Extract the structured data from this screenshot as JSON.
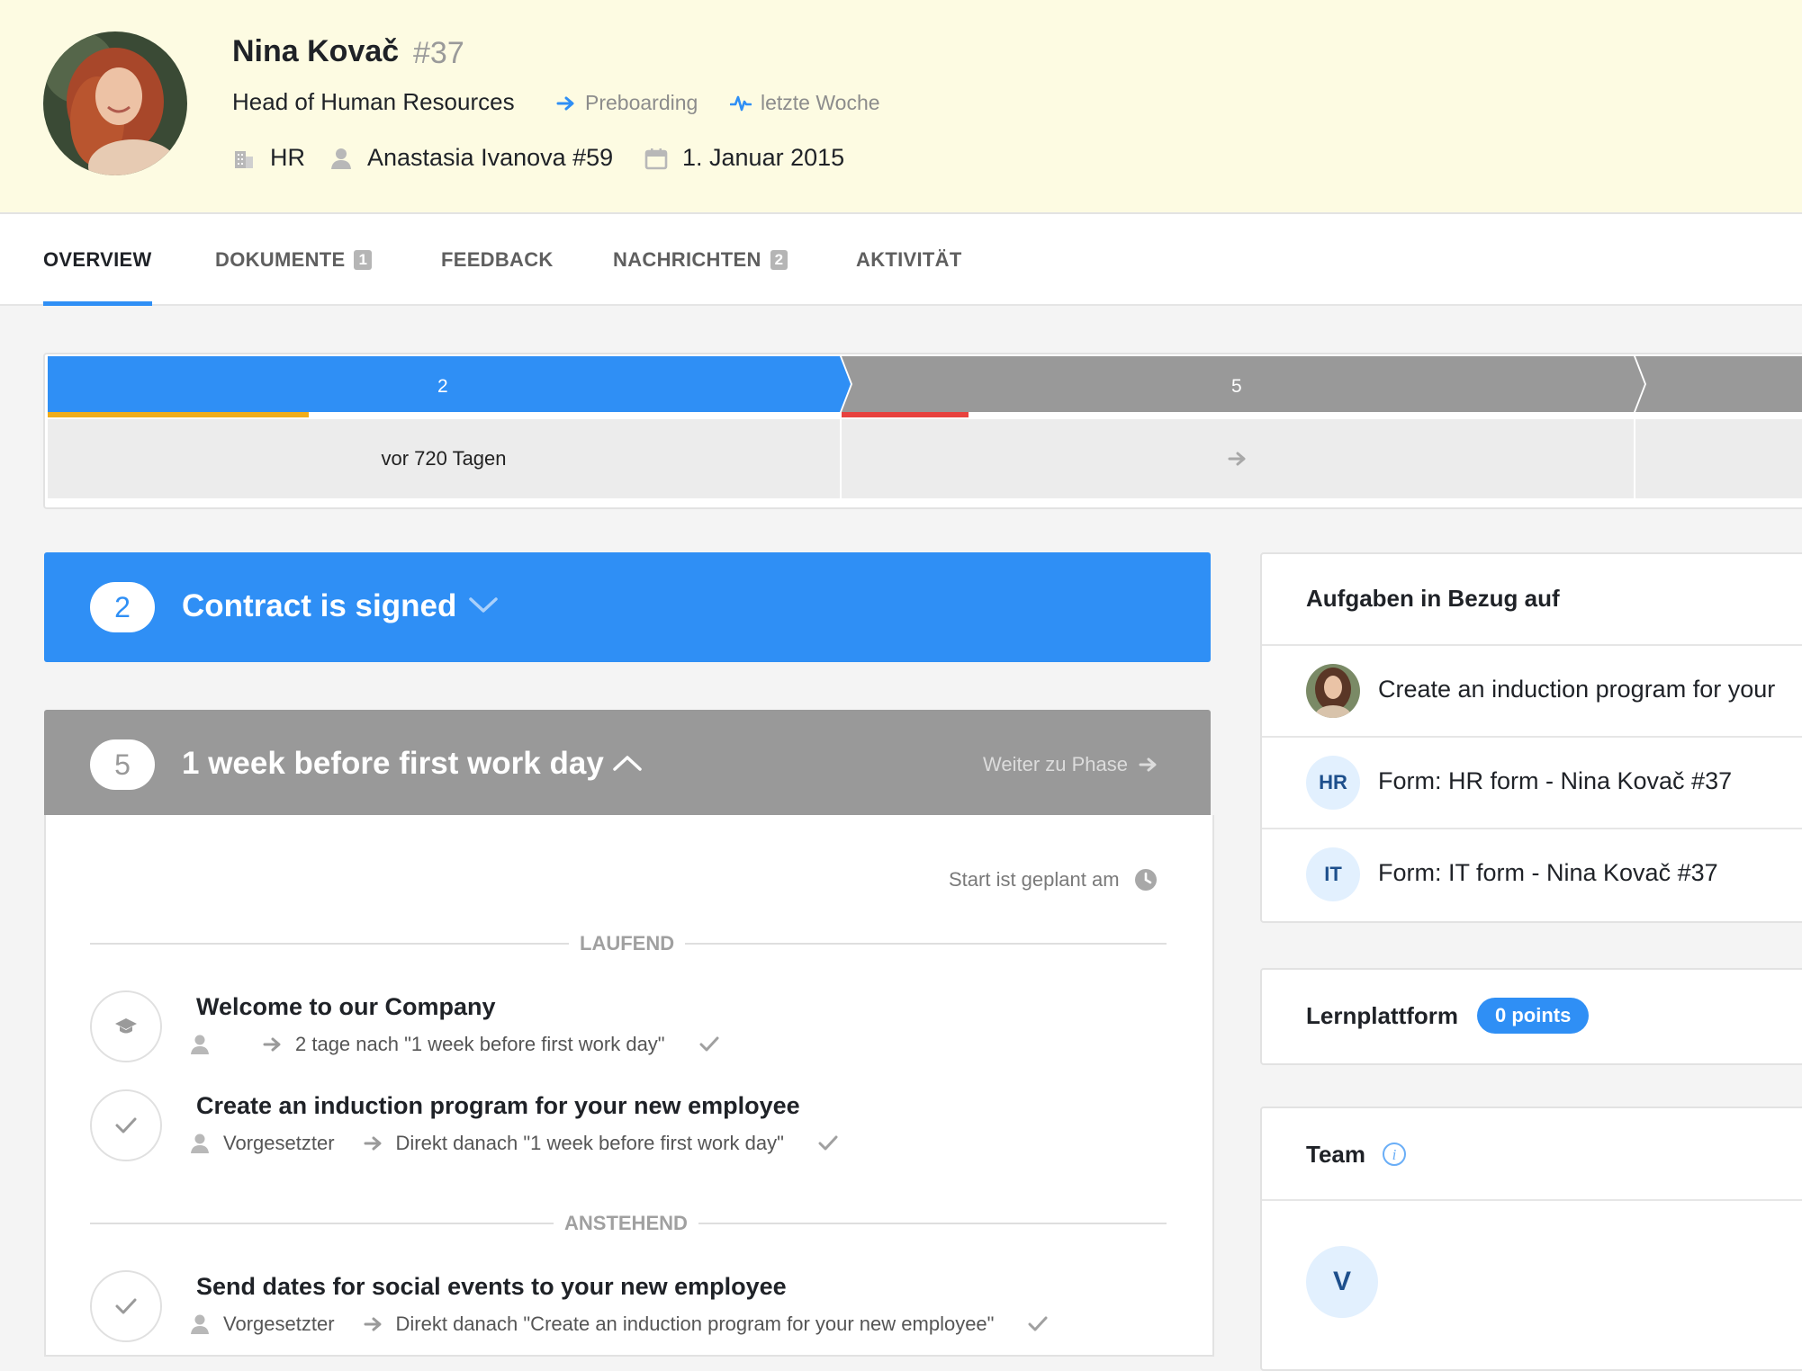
{
  "profile": {
    "name": "Nina Kovač",
    "id": "#37",
    "job_title": "Head of Human Resources",
    "stage_tag": "Preboarding",
    "activity_tag": "letzte Woche",
    "department": "HR",
    "manager": "Anastasia Ivanova #59",
    "start_date": "1. Januar 2015"
  },
  "tabs": [
    {
      "label": "OVERVIEW",
      "count": ""
    },
    {
      "label": "DOKUMENTE",
      "count": "1"
    },
    {
      "label": "FEEDBACK",
      "count": ""
    },
    {
      "label": "NACHRICHTEN",
      "count": "2"
    },
    {
      "label": "AKTIVITÄT",
      "count": ""
    }
  ],
  "phase_strip": {
    "phases": [
      {
        "number": "2",
        "cell_text": "vor 720 Tagen",
        "progress": 0.33,
        "progress_color": "#f0ad1b",
        "color": "#2f8ff5"
      },
      {
        "number": "5",
        "cell_text": "",
        "progress": 0.16,
        "progress_color": "#e8423f",
        "color": "#999999"
      }
    ]
  },
  "phase_cards": [
    {
      "number": "2",
      "title": "Contract is signed",
      "color": "#2f8ff5"
    },
    {
      "number": "5",
      "title": "1 week before first work day",
      "color": "#999999",
      "next_label": "Weiter zu Phase"
    }
  ],
  "schedule_text": "Start ist geplant am",
  "sections": {
    "running": "LAUFEND",
    "upcoming": "ANSTEHEND"
  },
  "tasks": [
    {
      "title": "Welcome to our Company",
      "assignee": "",
      "timing": "2 tage nach \"1 week before first work day\"",
      "icon": "graduation-cap-icon"
    },
    {
      "title": "Create an induction program for your new employee",
      "assignee": "Vorgesetzter",
      "timing": "Direkt danach \"1 week before first work day\"",
      "icon": "checkmark-icon"
    },
    {
      "title": "Send dates for social events to your new employee",
      "assignee": "Vorgesetzter",
      "timing": "Direkt danach \"Create an induction program for your new employee\"",
      "icon": "checkmark-icon"
    }
  ],
  "related_tasks": {
    "title": "Aufgaben in Bezug auf",
    "items": [
      {
        "badge": "",
        "text": "Create an induction program for your"
      },
      {
        "badge": "HR",
        "text": "Form: HR form - Nina Kovač #37"
      },
      {
        "badge": "IT",
        "text": "Form: IT form - Nina Kovač #37"
      }
    ]
  },
  "learning": {
    "title": "Lernplattform",
    "points": "0 points"
  },
  "team": {
    "title": "Team",
    "member_initial": "V"
  }
}
